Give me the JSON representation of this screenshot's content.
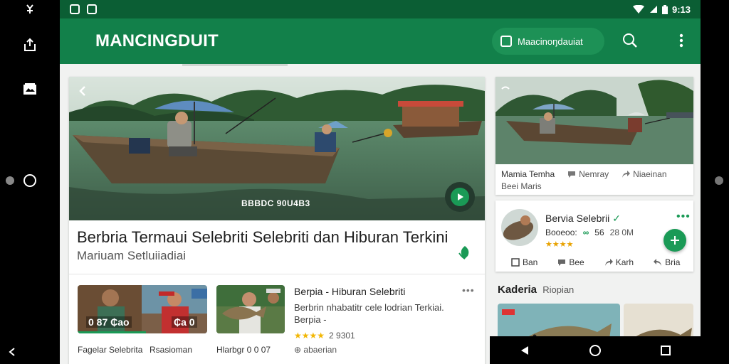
{
  "app": {
    "title": "MANCINGDUIT",
    "chip_label": "Maacinoŋdauiat"
  },
  "status": {
    "time": "9:13"
  },
  "hero": {
    "image_caption": "BBBDC 90U4B3",
    "headline": "Berbria Termaui Selebriti Selebriti dan Hiburan Terkini",
    "subtitle": "Mariuam Setluiiadiai"
  },
  "related": {
    "thumb1_badge_left": "0 87 ₵ao",
    "thumb1_badge_right": "₵a 0",
    "title": "Berpia - Hiburan Selebriti",
    "description": "Berbrin nhabatitr cele lodrian Terkiai. Berpia -",
    "stars": "★★★★",
    "rating_count": "2 9301",
    "caption1": "Fagelar Selebrita",
    "caption2": "Rsasioman",
    "caption3": "Hlarbgr 0 0 07",
    "caption4": "⊕ abaerian"
  },
  "side_card": {
    "item1": "Mamia Temha",
    "item2": "Nemray",
    "item3": "Niaeinan",
    "item4": "Beei Maris"
  },
  "profile_card": {
    "name": "Bervia Selebrii",
    "check": "✓",
    "meta_label": "Booeoo:",
    "meta_value": "56",
    "meta_count": "28 0M",
    "stars": "★★★★",
    "action1": "Ban",
    "action2": "Bee",
    "action3": "Karh",
    "action4": "Bria"
  },
  "section": {
    "title": "Kaderia",
    "subtitle": "Riopian"
  }
}
